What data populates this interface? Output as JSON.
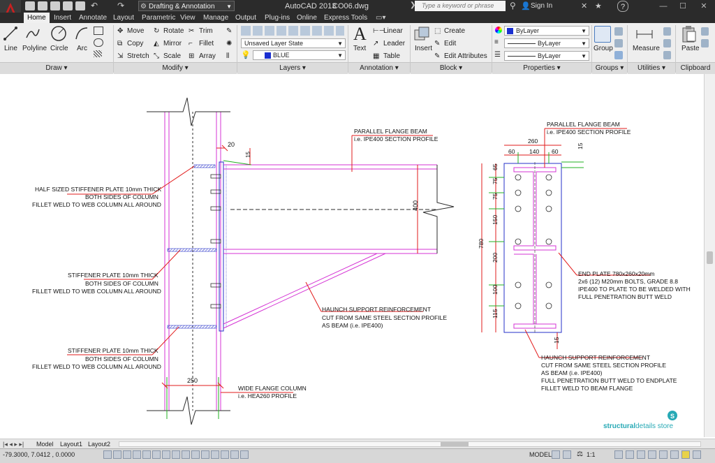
{
  "app": {
    "title": "AutoCAD 2013",
    "filename": "CO06.dwg",
    "workspace": "Drafting & Annotation",
    "search_placeholder": "Type a keyword or phrase",
    "sign_in": "Sign In"
  },
  "tabs": [
    "Home",
    "Insert",
    "Annotate",
    "Layout",
    "Parametric",
    "View",
    "Manage",
    "Output",
    "Plug-ins",
    "Online",
    "Express Tools"
  ],
  "ribbon": {
    "draw": {
      "title": "Draw",
      "tools": [
        "Line",
        "Polyline",
        "Circle",
        "Arc"
      ]
    },
    "modify": {
      "title": "Modify",
      "tools": [
        "Move",
        "Rotate",
        "Trim",
        "Copy",
        "Mirror",
        "Fillet",
        "Stretch",
        "Scale",
        "Array"
      ]
    },
    "layers": {
      "title": "Layers",
      "layer_state": "Unsaved Layer State",
      "current_layer": "BLUE"
    },
    "annotation": {
      "title": "Annotation",
      "tools": [
        "Text",
        "Linear",
        "Leader",
        "Table"
      ]
    },
    "block": {
      "title": "Block",
      "tools": [
        "Insert",
        "Create",
        "Edit",
        "Edit Attributes"
      ]
    },
    "properties": {
      "title": "Properties",
      "color": "ByLayer",
      "linetype": "ByLayer",
      "lineweight": "ByLayer"
    },
    "groups": {
      "title": "Groups",
      "tool": "Group"
    },
    "utilities": {
      "title": "Utilities",
      "tool": "Measure"
    },
    "clipboard": {
      "title": "Clipboard",
      "tool": "Paste"
    }
  },
  "drawing": {
    "left": {
      "dim_20": "20",
      "dim_15": "15",
      "dim_400": "400",
      "dim_250": "250",
      "beam_label_1": "PARALLEL FLANGE BEAM",
      "beam_label_2": "i.e. IPE400 SECTION PROFILE",
      "half_stiff_1": "HALF SIZED STIFFENER PLATE 10mm THICK",
      "half_stiff_2": "BOTH SIDES OF COLUMN",
      "half_stiff_3": "FILLET WELD TO WEB COLUMN ALL AROUND",
      "stiff_a_1": "STIFFENER PLATE 10mm THICK",
      "stiff_a_2": "BOTH SIDES OF COLUMN",
      "stiff_a_3": "FILLET WELD TO WEB COLUMN ALL AROUND",
      "stiff_b_1": "STIFFENER PLATE 10mm THICK",
      "stiff_b_2": "BOTH SIDES OF COLUMN",
      "stiff_b_3": "FILLET WELD TO WEB COLUMN ALL AROUND",
      "haunch_1": "HAUNCH SUPPORT REINFORCEMENT",
      "haunch_2": "CUT FROM SAME STEEL SECTION PROFILE",
      "haunch_3": "AS BEAM (i.e. IPE400)",
      "col_1": "WIDE FLANGE COLUMN",
      "col_2": "i.e. HEA260 PROFILE"
    },
    "right": {
      "beam_label_1": "PARALLEL FLANGE BEAM",
      "beam_label_2": "i.e. IPE400 SECTION PROFILE",
      "dim_260": "260",
      "dim_60a": "60",
      "dim_140": "140",
      "dim_60b": "60",
      "dim_15a": "15",
      "dim_15b": "15",
      "dim_780": "780",
      "dim_65": "65",
      "dim_75a": "75",
      "dim_75b": "75",
      "dim_150": "150",
      "dim_200": "200",
      "dim_100": "100",
      "dim_115": "115",
      "end_1": "END PLATE 780x260x20mm",
      "end_2": "2x6 (12) M20mm BOLTS, GRADE 8.8",
      "end_3": "IPE400 TO PLATE TO BE WELDED WITH",
      "end_4": "FULL PENETRATION BUTT WELD",
      "haunch_1": "HAUNCH SUPPORT REINFORCEMENT",
      "haunch_2": "CUT FROM SAME STEEL SECTION PROFILE",
      "haunch_3": "AS BEAM (i.e. IPE400)",
      "haunch_4": "FULL PENETRATION BUTT WELD TO ENDPLATE",
      "haunch_5": "FILLET WELD TO BEAM FLANGE"
    },
    "watermark": {
      "brand_bold": "structural",
      "brand_rest": "details store"
    }
  },
  "layout_tabs": [
    "Model",
    "Layout1",
    "Layout2"
  ],
  "status": {
    "coordinates": "-79.3000, 7.0412 , 0.0000",
    "mode": "MODEL",
    "scale": "1:1"
  },
  "colors": {
    "dark_ui": "#2b2b2b",
    "ribbon": "#eeeeee",
    "magenta": "#d433d4",
    "green": "#22b022",
    "red": "#e21b1b",
    "blue": "#2430c8"
  }
}
